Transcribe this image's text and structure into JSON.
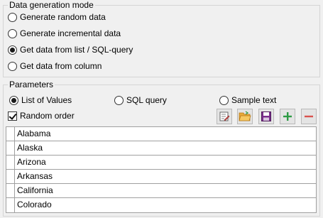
{
  "mode_group": {
    "title": "Data generation mode",
    "options": [
      {
        "label": "Generate random data",
        "checked": false
      },
      {
        "label": "Generate incremental data",
        "checked": false
      },
      {
        "label": "Get data from list / SQL-query",
        "checked": true
      },
      {
        "label": "Get data from column",
        "checked": false
      }
    ]
  },
  "params_group": {
    "title": "Parameters",
    "source_options": [
      {
        "label": "List of Values",
        "checked": true
      },
      {
        "label": "SQL query",
        "checked": false
      },
      {
        "label": "Sample text",
        "checked": false
      }
    ],
    "random_order": {
      "label": "Random order",
      "checked": true
    },
    "toolbar": [
      {
        "name": "edit-list-icon"
      },
      {
        "name": "open-folder-icon"
      },
      {
        "name": "save-icon"
      },
      {
        "name": "add-icon"
      },
      {
        "name": "remove-icon"
      }
    ]
  },
  "values": [
    "Alabama",
    "Alaska",
    "Arizona",
    "Arkansas",
    "California",
    "Colorado"
  ],
  "colors": {
    "add": "#2e9b45",
    "remove": "#d9534f",
    "save": "#7a2d8c",
    "folder": "#e8a93a"
  }
}
